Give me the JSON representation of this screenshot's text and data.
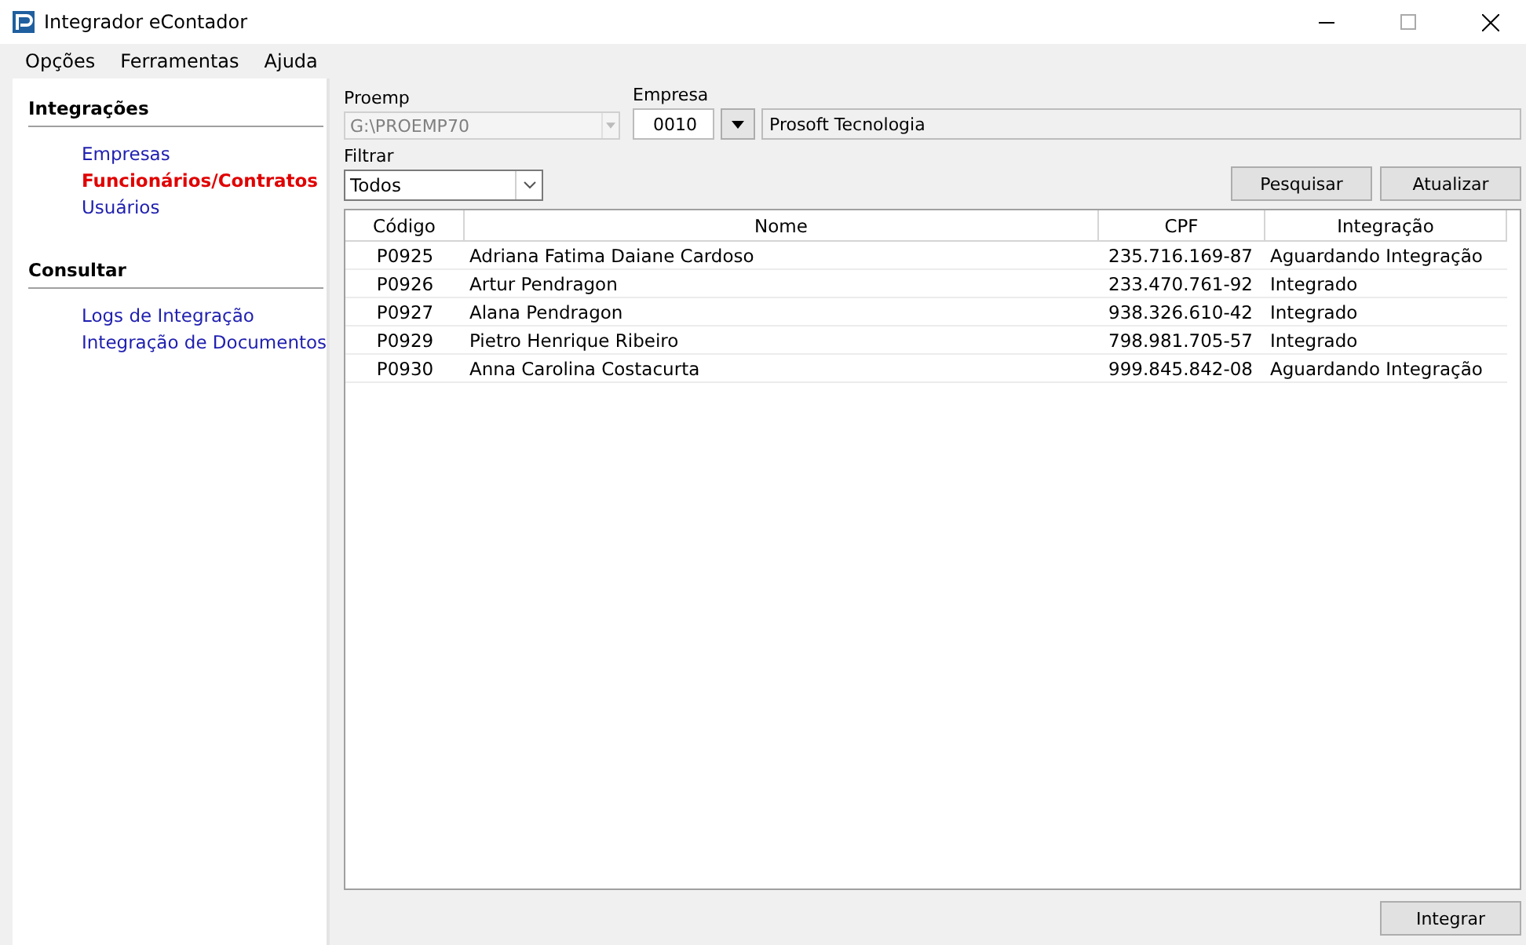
{
  "window": {
    "title": "Integrador eContador"
  },
  "menu": [
    "Opções",
    "Ferramentas",
    "Ajuda"
  ],
  "sidebar": {
    "sections": [
      {
        "title": "Integrações",
        "items": [
          {
            "label": "Empresas",
            "selected": false
          },
          {
            "label": "Funcionários/Contratos",
            "selected": true
          },
          {
            "label": "Usuários",
            "selected": false
          }
        ]
      },
      {
        "title": "Consultar",
        "items": [
          {
            "label": "Logs de Integração",
            "selected": false
          },
          {
            "label": "Integração de Documentos",
            "selected": false
          }
        ]
      }
    ]
  },
  "proemp": {
    "label": "Proemp",
    "value": "G:\\PROEMP70",
    "disabled": true
  },
  "empresa": {
    "label": "Empresa",
    "code": "0010",
    "name": "Prosoft Tecnologia"
  },
  "filtrar": {
    "label": "Filtrar",
    "value": "Todos"
  },
  "buttons": {
    "search": "Pesquisar",
    "refresh": "Atualizar",
    "integrate": "Integrar"
  },
  "table": {
    "columns": [
      "Código",
      "Nome",
      "CPF",
      "Integração"
    ],
    "rows": [
      [
        "P0925",
        "Adriana Fatima Daiane Cardoso",
        "235.716.169-87",
        "Aguardando Integração"
      ],
      [
        "P0926",
        "Artur Pendragon",
        "233.470.761-92",
        "Integrado"
      ],
      [
        "P0927",
        "Alana Pendragon",
        "938.326.610-42",
        "Integrado"
      ],
      [
        "P0929",
        "Pietro Henrique Ribeiro",
        "798.981.705-57",
        "Integrado"
      ],
      [
        "P0930",
        "Anna Carolina Costacurta",
        "999.845.842-08",
        "Aguardando Integração"
      ]
    ]
  }
}
